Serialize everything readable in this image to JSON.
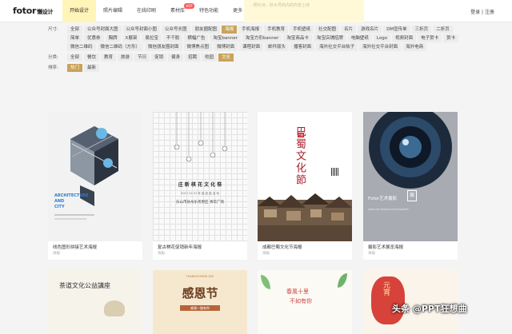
{
  "header": {
    "logo": "fotor",
    "logo_suffix": "懒设计",
    "nav": [
      "开始设计",
      "照片编辑",
      "在线印刷",
      "素材库",
      "特色功能",
      "更多"
    ],
    "hot_badge": "HOT",
    "banner_text": "…照片对…秒大号的内的内容上线",
    "login": "登录",
    "register": "注册"
  },
  "filters": {
    "size_label": "尺寸:",
    "size_tags": [
      "全部",
      "公众号封面大图",
      "公众号封面小图",
      "公众号长图",
      "朋友圈配图",
      "海报",
      "手机海报",
      "手机教育",
      "手机壁纸",
      "社交配图",
      "名片",
      "游戏名片",
      "DM宣传单",
      "三折页",
      "二折页",
      "简单",
      "优惠券",
      "胸牌",
      "X展架",
      "易拉宝",
      "不干胶",
      "横幅广告",
      "淘宝banner",
      "淘宝方形banner",
      "淘宝商品卡",
      "淘宝店铺招牌",
      "电脑壁纸",
      "Logo",
      "视频封面",
      "电子贺卡",
      "贺卡",
      "微信二维码",
      "微信二维码（方形）",
      "微信朋友圈封面",
      "微博焦点图",
      "微博封面",
      "课程封面",
      "邮件版头",
      "播客封面",
      "海外社交平台帖子",
      "海外社交平台封面",
      "海外电商"
    ],
    "size_active": "海报",
    "cat_label": "分类:",
    "cat_tags": [
      "全部",
      "餐饮",
      "教育",
      "旅游",
      "节日",
      "促销",
      "健身",
      "招聘",
      "校园",
      "文化"
    ],
    "cat_active": "文化",
    "sort_label": "排序:",
    "sort_tags": [
      "热门",
      "最新"
    ],
    "sort_active": "热门"
  },
  "cards": [
    {
      "title": "线色图形拼接艺术海报",
      "sub": "海报"
    },
    {
      "title": "复古棋花促销新年海报",
      "sub": "海报"
    },
    {
      "title": "成都巴蜀文化节海报",
      "sub": "海报"
    },
    {
      "title": "摄影艺术展览海报",
      "sub": "海报"
    }
  ],
  "posters": {
    "p1_title1": "ARCHITECTURE",
    "p1_title2": "AND",
    "p1_title3": "CITY",
    "p2_title": "庄 新 棋 花 文 化 祭",
    "p2_date": "2017.12.31 年 品 品 品 活 动",
    "p2_loc": "乐山市县州乐考原区 青年广场",
    "p3_title": "巴蜀文化節",
    "p3_seal": "巴蜀",
    "p4_title": "Fotor艺术摄影",
    "p4_badge": "展",
    "p4_sub": "CREATIVE DESIGN PHOTOGRAPHY",
    "r2_1": "茶道文化公益講座",
    "r2_2_top": "THANKSGIVING DAY",
    "r2_2": "感恩节",
    "r2_2_sub": "感谢一路有你",
    "r2_3a": "春風十里",
    "r2_3b": "不如有你",
    "r2_4": "元宵"
  },
  "watermark": "头条 @PPT狂想曲"
}
